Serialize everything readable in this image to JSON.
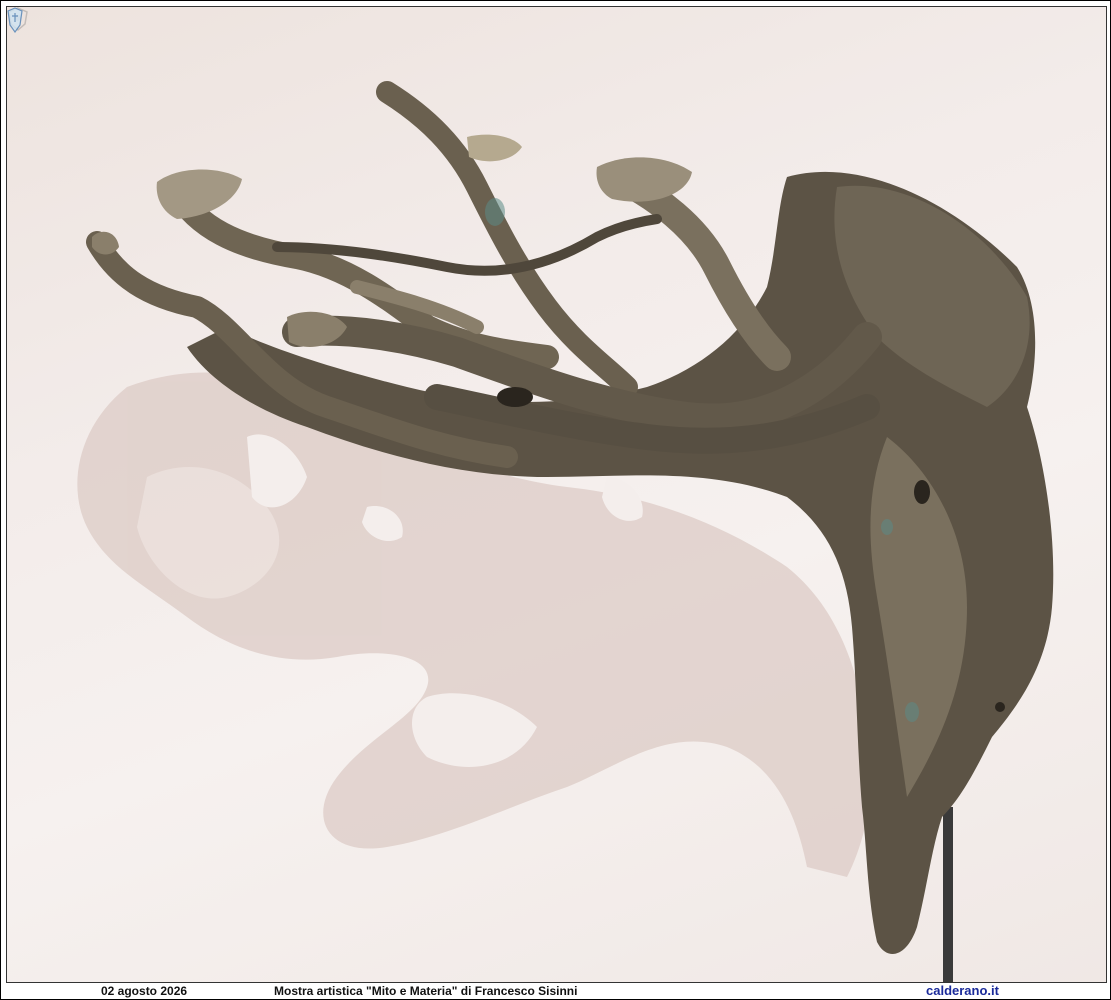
{
  "photo": {
    "subject": "driftwood-sculpture",
    "colors": {
      "wall": "#f3ecea",
      "shadow": "#d9c8c2",
      "wood_dark": "#4a4236",
      "wood_mid": "#6b6150",
      "wood_light": "#a39884",
      "stand": "#3a3a3a"
    }
  },
  "caption": {
    "date": "02 agosto 2026",
    "title": "Mostra artistica \"Mito e Materia\" di Francesco Sisinni",
    "site": "calderano.it"
  },
  "icons": {
    "top_emblem": "crest-icon",
    "bottom_emblem": "crest-icon"
  }
}
